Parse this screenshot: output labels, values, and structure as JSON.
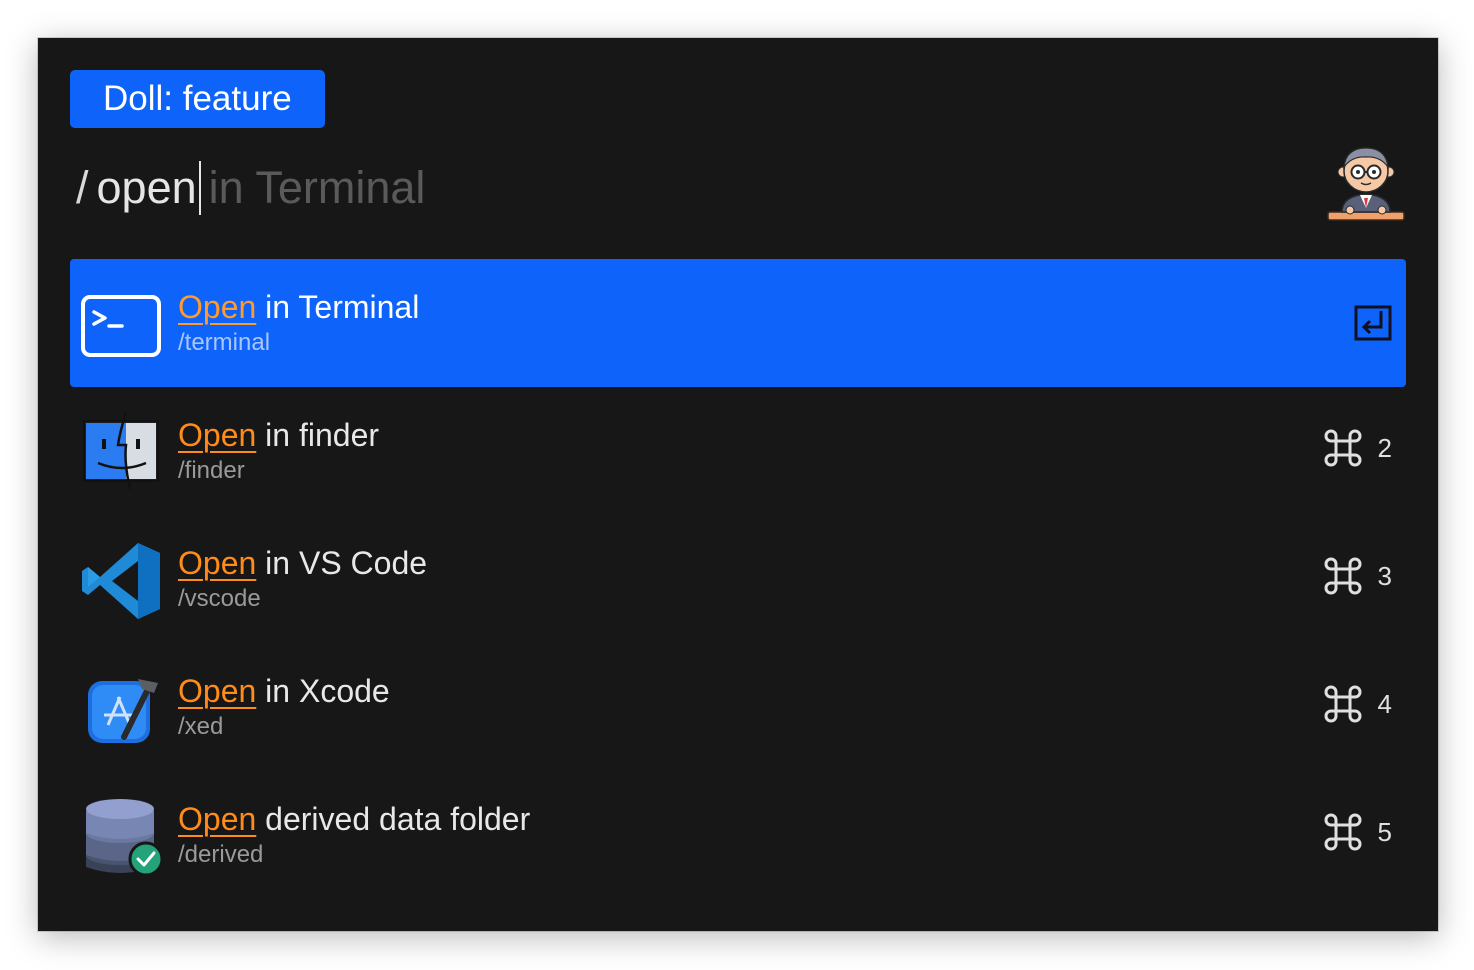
{
  "badge": {
    "label": "Doll: feature"
  },
  "query": {
    "prefix": "/",
    "typed": "open",
    "suggestion": "in Terminal"
  },
  "avatar": {
    "icon": "doll-avatar-icon"
  },
  "colors": {
    "accent": "#0d63fa",
    "highlight": "#ff8c1a",
    "background": "#171717"
  },
  "results": [
    {
      "match": "Open",
      "rest": " in Terminal",
      "command": "/terminal",
      "icon": "terminal-icon",
      "shortcut_key": "",
      "shortcut_glyph": "enter-icon",
      "selected": true
    },
    {
      "match": "Open",
      "rest": " in finder",
      "command": "/finder",
      "icon": "finder-icon",
      "shortcut_key": "2",
      "shortcut_glyph": "command-icon",
      "selected": false
    },
    {
      "match": "Open",
      "rest": " in VS Code",
      "command": "/vscode",
      "icon": "vscode-icon",
      "shortcut_key": "3",
      "shortcut_glyph": "command-icon",
      "selected": false
    },
    {
      "match": "Open",
      "rest": " in Xcode",
      "command": "/xed",
      "icon": "xcode-icon",
      "shortcut_key": "4",
      "shortcut_glyph": "command-icon",
      "selected": false
    },
    {
      "match": "Open",
      "rest": " derived data folder",
      "command": "/derived",
      "icon": "database-icon",
      "shortcut_key": "5",
      "shortcut_glyph": "command-icon",
      "selected": false
    }
  ]
}
